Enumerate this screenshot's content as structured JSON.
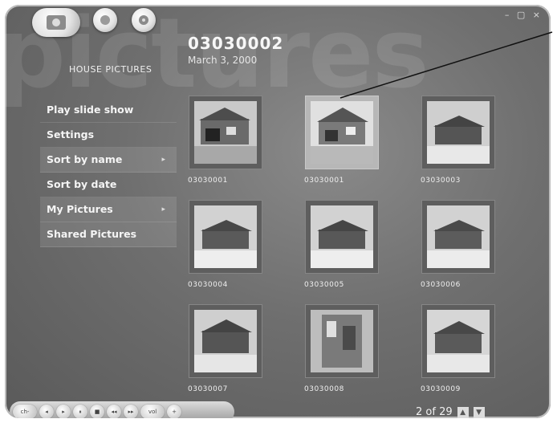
{
  "window": {
    "controls": "– ▢ ×"
  },
  "toolbar": {
    "home_icon": "media-center-logo-icon",
    "back_icon": "back-icon",
    "media_icon": "media-icon"
  },
  "background_watermark": "pictures",
  "header": {
    "section": "HOUSE PICTURES",
    "title": "03030002",
    "date": "March 3, 2000"
  },
  "menu": {
    "items": [
      {
        "label": "Play slide show",
        "has_caret": false
      },
      {
        "label": "Settings",
        "has_caret": false
      },
      {
        "label": "Sort by name",
        "has_caret": true
      },
      {
        "label": "Sort by date",
        "has_caret": false
      },
      {
        "label": "My Pictures",
        "has_caret": true
      },
      {
        "label": "Shared Pictures",
        "has_caret": false
      }
    ],
    "caret_glyph": "▸"
  },
  "grid": {
    "items": [
      {
        "label": "03030001",
        "selected": false
      },
      {
        "label": "03030001",
        "selected": true
      },
      {
        "label": "03030003",
        "selected": false
      },
      {
        "label": "03030004",
        "selected": false
      },
      {
        "label": "03030005",
        "selected": false
      },
      {
        "label": "03030006",
        "selected": false
      },
      {
        "label": "03030007",
        "selected": false
      },
      {
        "label": "03030008",
        "selected": false
      },
      {
        "label": "03030009",
        "selected": false
      }
    ]
  },
  "transport": {
    "buttons": [
      "ch-",
      "◂",
      "▸",
      "⏸",
      "■",
      "◂◂",
      "▸▸",
      "vol",
      "+"
    ]
  },
  "pager": {
    "text": "2 of 29",
    "up": "▲",
    "down": "▼"
  },
  "colors": {
    "background": "#6f6f6f",
    "text": "#f4f4f4",
    "selected_thumb": "#b7b7b7"
  }
}
